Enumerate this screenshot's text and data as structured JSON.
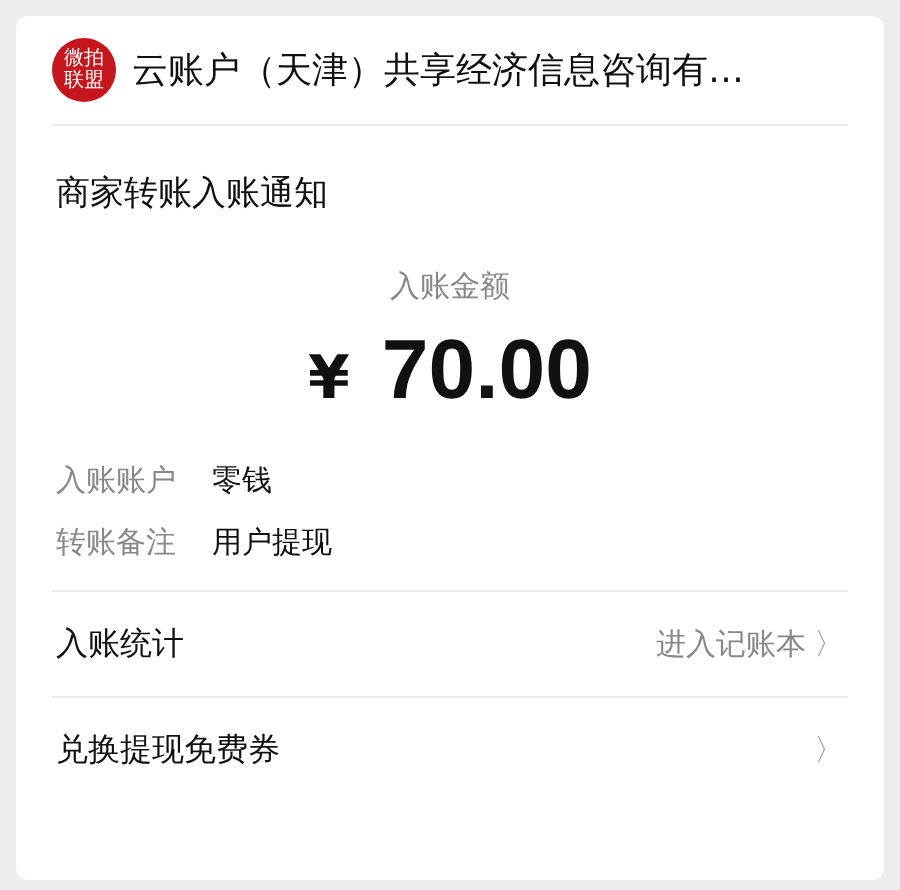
{
  "header": {
    "logo_lines": [
      "微拍",
      "联盟"
    ],
    "title": "云账户（天津）共享经济信息咨询有…"
  },
  "notice": {
    "title": "商家转账入账通知",
    "amount_label": "入账金额",
    "currency": "¥",
    "amount": "70.00",
    "details": [
      {
        "label": "入账账户",
        "value": "零钱"
      },
      {
        "label": "转账备注",
        "value": "用户提现"
      }
    ]
  },
  "links": [
    {
      "label": "入账统计",
      "action": "进入记账本",
      "chevron": "〉"
    },
    {
      "label": "兑换提现免费券",
      "chevron": "〉"
    }
  ]
}
